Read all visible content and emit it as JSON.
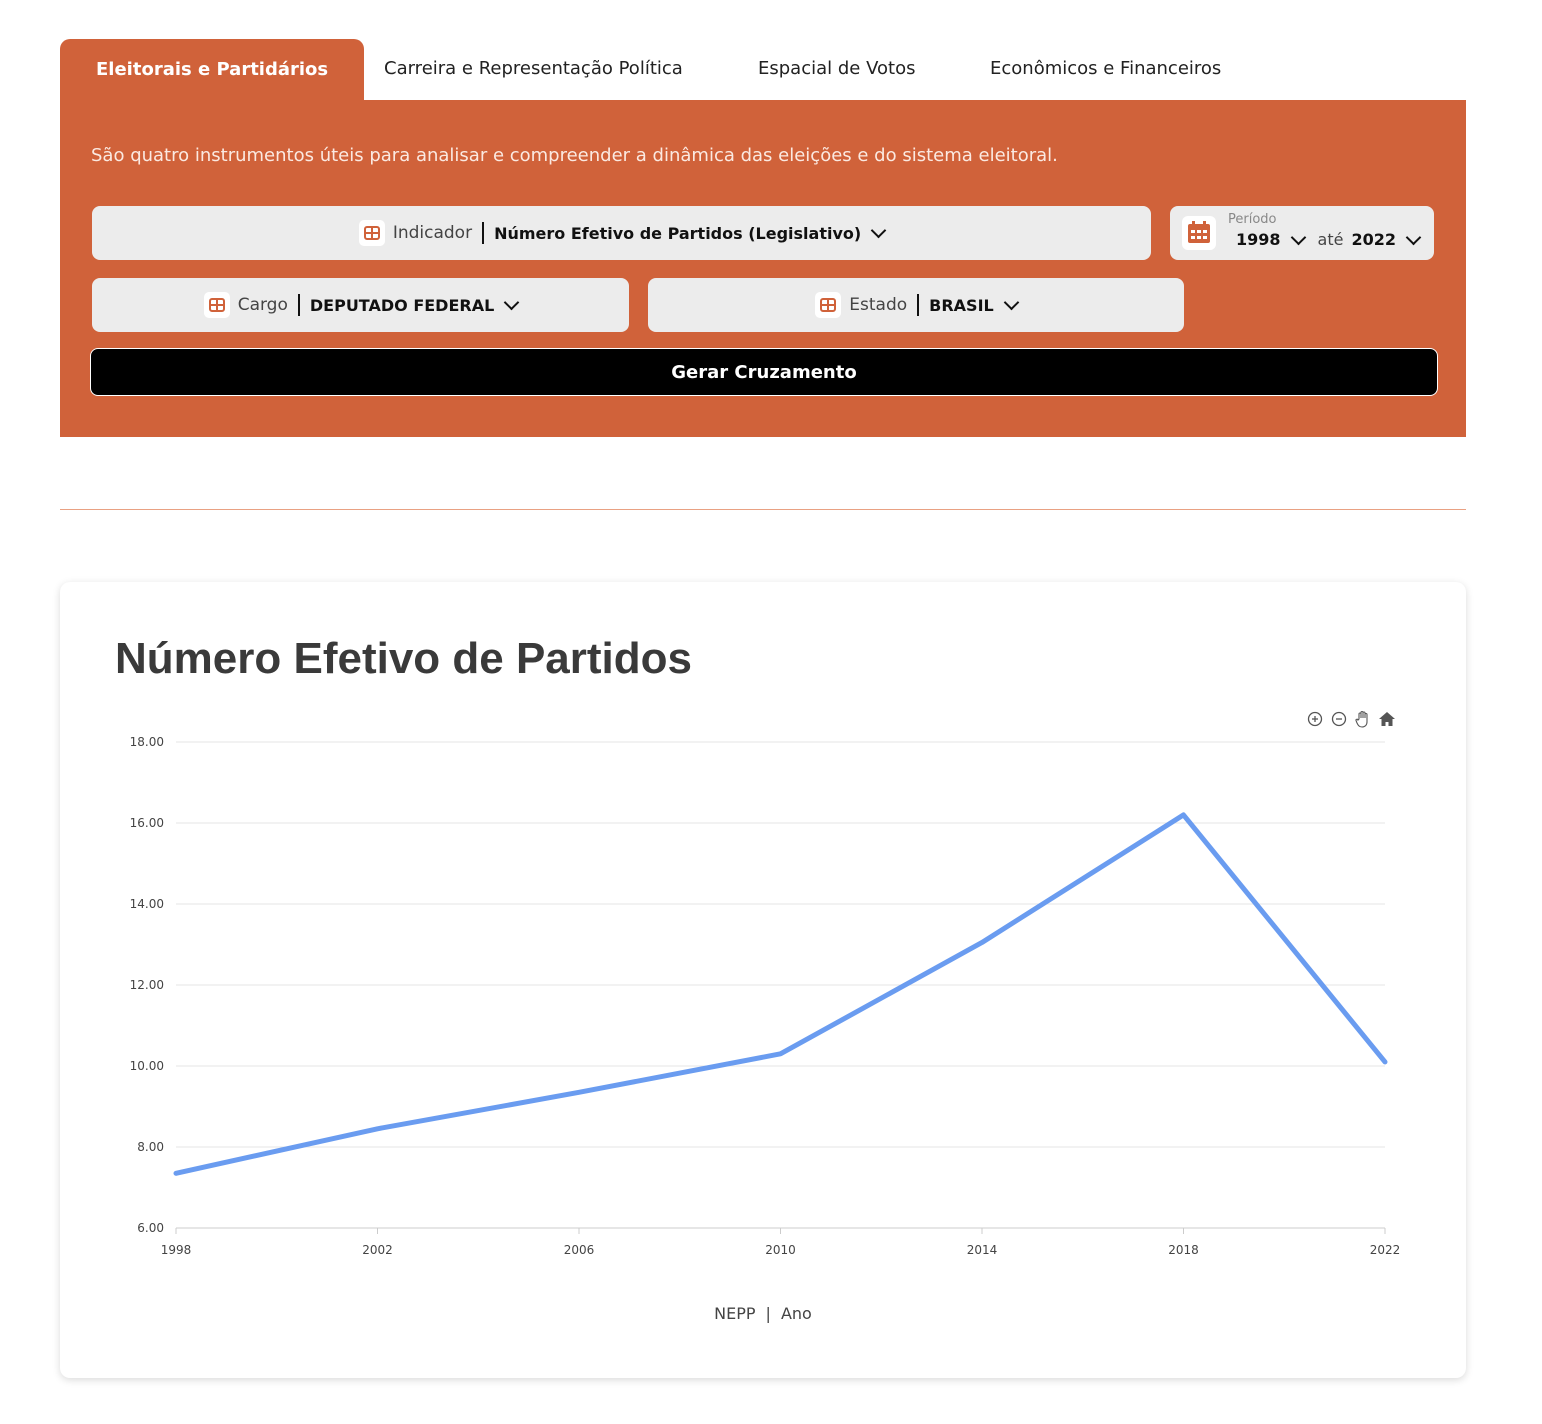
{
  "tabs": [
    {
      "label": "Eleitorais e Partidários",
      "active": true
    },
    {
      "label": "Carreira e Representação Política",
      "active": false
    },
    {
      "label": "Espacial de Votos",
      "active": false
    },
    {
      "label": "Econômicos e Financeiros",
      "active": false
    }
  ],
  "panel": {
    "description": "São quatro instrumentos úteis para analisar e compreender a dinâmica das eleições e do sistema eleitoral.",
    "indicador": {
      "label": "Indicador",
      "value": "Número Efetivo de Partidos (Legislativo)"
    },
    "periodo": {
      "label": "Período",
      "from": "1998",
      "to_label": "até",
      "to": "2022"
    },
    "cargo": {
      "label": "Cargo",
      "value": "DEPUTADO FEDERAL"
    },
    "estado": {
      "label": "Estado",
      "value": "BRASIL"
    },
    "button": "Gerar Cruzamento"
  },
  "colors": {
    "accent": "#d0623a",
    "line": "#6a9cf0"
  },
  "chart_caption": {
    "source": "NEPP",
    "sep": "|",
    "axis": "Ano"
  },
  "chart_data": {
    "type": "line",
    "title": "Número Efetivo de Partidos",
    "x": [
      1998,
      2002,
      2006,
      2010,
      2014,
      2018,
      2022
    ],
    "series": [
      {
        "values": [
          7.35,
          8.45,
          9.35,
          10.3,
          13.05,
          16.2,
          10.1
        ]
      }
    ],
    "xlabel": "Ano",
    "ylim": [
      6,
      18
    ],
    "yticks": [
      "6.00",
      "8.00",
      "10.00",
      "12.00",
      "14.00",
      "16.00",
      "18.00"
    ],
    "xticks": [
      "1998",
      "2002",
      "2006",
      "2010",
      "2014",
      "2018",
      "2022"
    ],
    "grid": true
  }
}
